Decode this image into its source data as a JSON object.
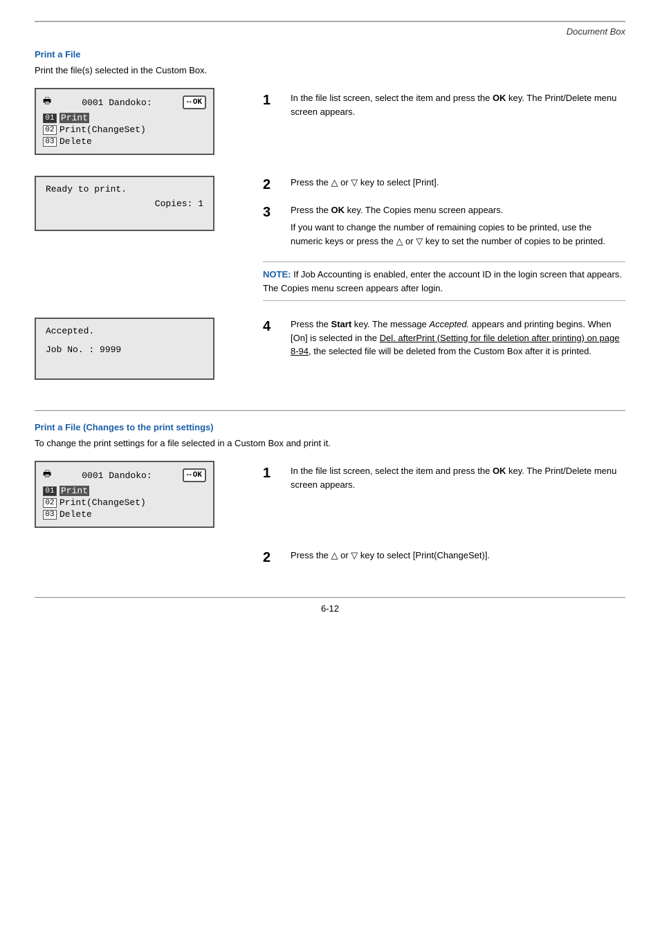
{
  "header": {
    "doc_box_label": "Document Box"
  },
  "section1": {
    "title": "Print a File",
    "intro": "Print the file(s) selected in the Custom Box.",
    "screen1": {
      "top_text": "0001 Dandoko:",
      "ok_button": "OK",
      "arrow": "⇔",
      "item1_num": "01",
      "item1_label": "Print",
      "item1_selected": true,
      "item2_num": "02",
      "item2_label": "Print(ChangeSet)",
      "item3_num": "03",
      "item3_label": "Delete"
    },
    "screen2": {
      "line1": "Ready to print.",
      "line2": "Copies: 1"
    },
    "screen3": {
      "line1": "Accepted.",
      "line2": "Job No. :    9999"
    },
    "steps": [
      {
        "num": "1",
        "text": "In the file list screen, select the item and press the ",
        "bold": "OK",
        "text2": " key. The Print/Delete menu screen appears."
      },
      {
        "num": "2",
        "text": "Press the △ or ▽ key to select [Print]."
      },
      {
        "num": "3",
        "text_pre": "Press the ",
        "bold": "OK",
        "text_post": " key. The Copies menu screen appears.",
        "sub_text": "If you want to change the number of remaining copies to be printed, use the numeric keys or press the △ or ▽ key to set the number of copies to be printed."
      },
      {
        "num": "4",
        "text_pre": "Press the ",
        "bold_start": "Start",
        "text_mid": " key. The message ",
        "italic": "Accepted.",
        "text_post": " appears and printing begins. When [On] is selected in the ",
        "underline": "Del. afterPrint (Setting for file deletion after printing) on page 8-94",
        "text_end": ", the selected file will be deleted from the Custom Box after it is printed."
      }
    ],
    "note": {
      "label": "NOTE:",
      "text": " If Job Accounting is enabled, enter the account ID in the login screen that appears. The Copies menu screen appears after login."
    }
  },
  "section2": {
    "title": "Print a File (Changes to the print settings)",
    "intro": "To change the print settings for a file selected in a Custom Box and print it.",
    "screen1": {
      "top_text": "0001 Dandoko:",
      "ok_button": "OK",
      "arrow": "⇔",
      "item1_num": "01",
      "item1_label": "Print",
      "item1_selected": true,
      "item2_num": "02",
      "item2_label": "Print(ChangeSet)",
      "item3_num": "03",
      "item3_label": "Delete"
    },
    "steps": [
      {
        "num": "1",
        "text": "In the file list screen, select the item and press the ",
        "bold": "OK",
        "text2": " key. The Print/Delete menu screen appears."
      },
      {
        "num": "2",
        "text": "Press the △ or ▽ key to select [Print(ChangeSet)]."
      }
    ]
  },
  "footer": {
    "page_number": "6-12"
  }
}
